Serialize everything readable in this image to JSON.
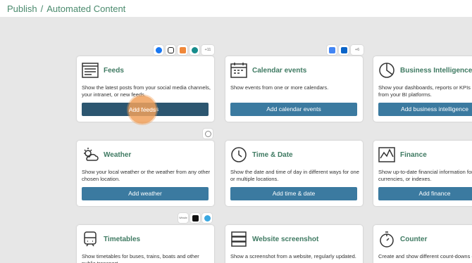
{
  "breadcrumb": {
    "root": "Publish",
    "separator": "/",
    "current": "Automated Content"
  },
  "cards": {
    "feeds": {
      "title": "Feeds",
      "description": "Show the latest posts from your social media channels, your intranet, or new feeds.",
      "button": "Add feeds"
    },
    "calendar": {
      "title": "Calendar events",
      "description": "Show events from one or more calendars.",
      "button": "Add calendar events"
    },
    "bi": {
      "title": "Business Intelligence",
      "description": "Show your dashboards, reports or KPIs straight from your BI platforms.",
      "button": "Add business intelligence"
    },
    "weather": {
      "title": "Weather",
      "description": "Show your local weather or the weather from any other chosen location.",
      "button": "Add weather"
    },
    "timedate": {
      "title": "Time & Date",
      "description": "Show the date and time of day in different ways for one or multiple locations.",
      "button": "Add time & date"
    },
    "finance": {
      "title": "Finance",
      "description": "Show up-to-date financial information for currencies, or indexes.",
      "button": "Add finance"
    },
    "timetables": {
      "title": "Timetables",
      "description": "Show timetables for buses, trains, boats and other public transport.",
      "button": ""
    },
    "screenshot": {
      "title": "Website screenshot",
      "description": "Show a screenshot from a website, regularly updated.",
      "button": ""
    },
    "counter": {
      "title": "Counter",
      "description": "Create and show different count-downs or...",
      "button": ""
    }
  },
  "badges": {
    "feeds_more": "+11",
    "calendar_more": "+6",
    "timetable_labels": [
      "Whistle",
      "",
      ""
    ]
  },
  "cursor_label": "Add feeds",
  "colors": {
    "accent": "#3b7aa0",
    "title_green": "#3f7a62",
    "background": "#e7e7e7"
  }
}
